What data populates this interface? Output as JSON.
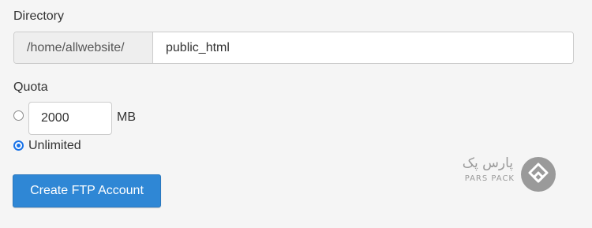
{
  "directory": {
    "label": "Directory",
    "prefix": "/home/allwebsite/",
    "value": "public_html"
  },
  "quota": {
    "label": "Quota",
    "limit_value": "2000",
    "unit": "MB",
    "unlimited_label": "Unlimited",
    "selected": "unlimited"
  },
  "actions": {
    "create_label": "Create FTP Account"
  },
  "watermark": {
    "text_fa": "پارس پک",
    "text_en": "PARS PACK",
    "icon": "parspack-logo-icon"
  },
  "colors": {
    "accent": "#2f87d5",
    "radio_selected": "#1a73e8",
    "background": "#f5f5f5"
  }
}
